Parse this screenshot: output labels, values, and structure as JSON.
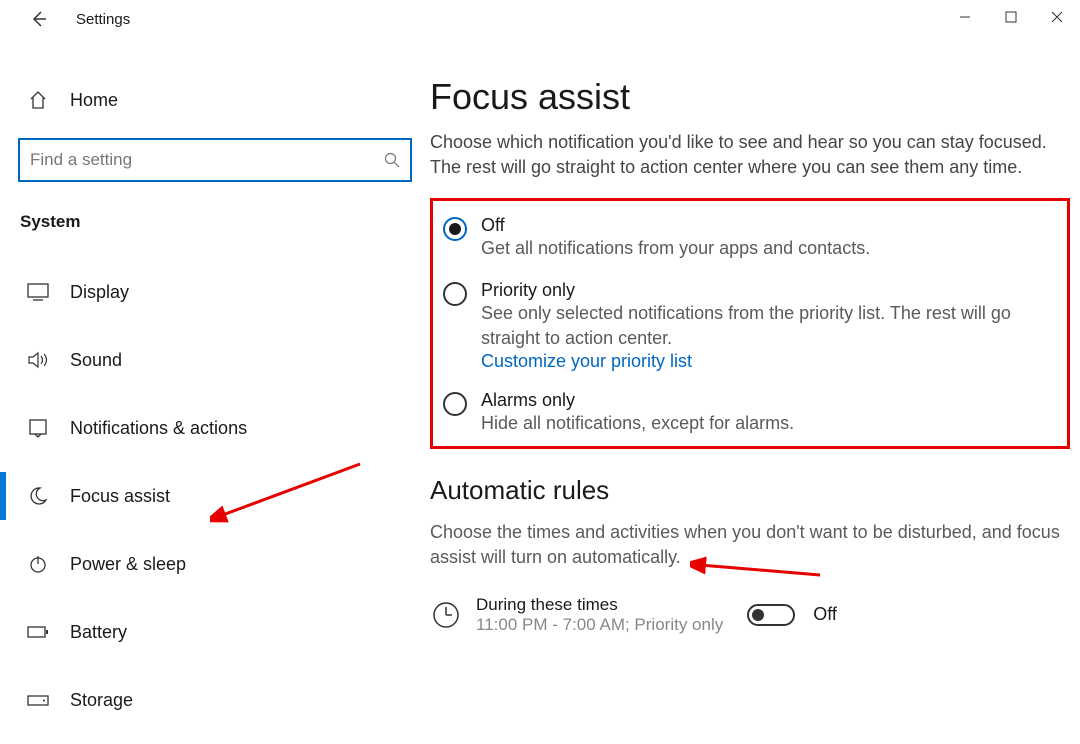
{
  "window": {
    "title": "Settings"
  },
  "sidebar": {
    "home_label": "Home",
    "search_placeholder": "Find a setting",
    "section_label": "System",
    "items": [
      {
        "label": "Display"
      },
      {
        "label": "Sound"
      },
      {
        "label": "Notifications & actions"
      },
      {
        "label": "Focus assist"
      },
      {
        "label": "Power & sleep"
      },
      {
        "label": "Battery"
      },
      {
        "label": "Storage"
      }
    ]
  },
  "main": {
    "title": "Focus assist",
    "description": "Choose which notification you'd like to see and hear so you can stay focused. The rest will go straight to action center where you can see them any time.",
    "options": [
      {
        "label": "Off",
        "description": "Get all notifications from your apps and contacts."
      },
      {
        "label": "Priority only",
        "description": "See only selected notifications from the priority list. The rest will go straight to action center.",
        "link_label": "Customize your priority list"
      },
      {
        "label": "Alarms only",
        "description": "Hide all notifications, except for alarms."
      }
    ],
    "auto_rules": {
      "heading": "Automatic rules",
      "description": "Choose the times and activities when you don't want to be disturbed, and focus assist will turn on automatically.",
      "rule1": {
        "label": "During these times",
        "sub": "11:00 PM - 7:00 AM; Priority only",
        "toggle_label": "Off"
      }
    }
  }
}
